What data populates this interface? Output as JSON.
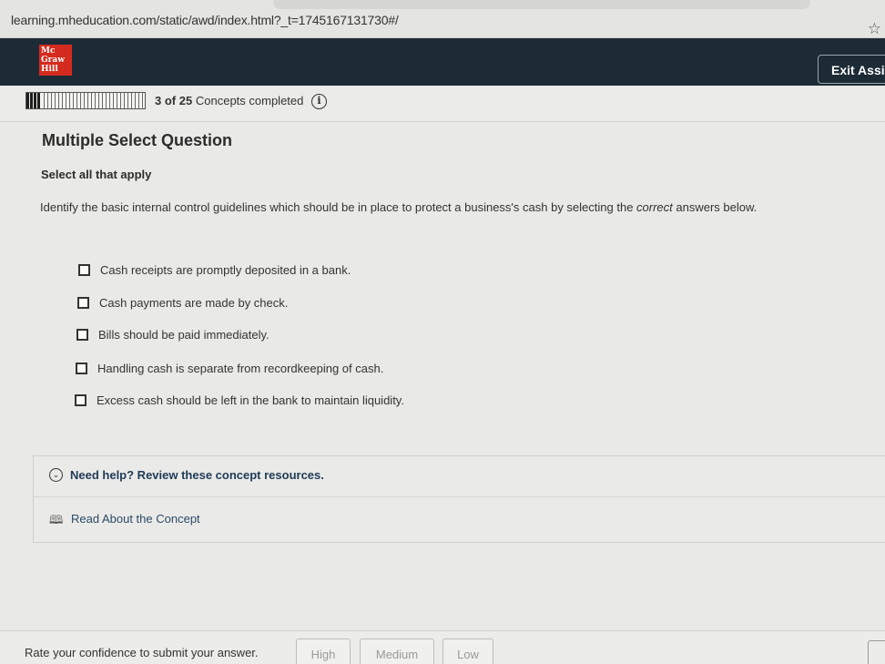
{
  "browser": {
    "url": "learning.mheducation.com/static/awd/index.html?_t=1745167131730#/",
    "bookmark_icon": "star-outline-icon"
  },
  "header": {
    "logo_lines": [
      "Mc",
      "Graw",
      "Hill"
    ],
    "exit_label": "Exit Assig",
    "brand_color": "#d52b1e",
    "bar_color": "#1d2b36"
  },
  "progress": {
    "completed": "3",
    "total": "25",
    "of_word": "of",
    "suffix": "Concepts completed",
    "fraction": 0.12,
    "info_icon": "info-icon"
  },
  "question": {
    "type_label": "Multiple Select Question",
    "instruction": "Select all that apply",
    "prompt_before": "Identify the basic internal control guidelines which should be in place to protect a business's cash by selecting the ",
    "prompt_emph": "correct",
    "prompt_after": " answers below.",
    "options": [
      "Cash receipts are promptly deposited in a bank.",
      "Cash payments are made by check.",
      "Bills should be paid immediately.",
      "Handling cash is separate from recordkeeping of cash.",
      "Excess cash should be left in the bank to maintain liquidity."
    ]
  },
  "help": {
    "title": "Need help? Review these concept resources.",
    "read_link": "Read About the Concept"
  },
  "footer": {
    "rate_label": "Rate your confidence to submit your answer.",
    "buttons": [
      "High",
      "Medium",
      "Low"
    ]
  }
}
